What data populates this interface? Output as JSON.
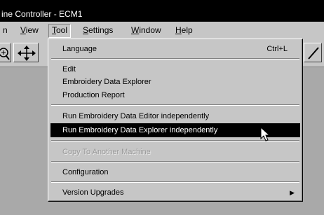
{
  "window": {
    "title": "ine Controller - ECM1"
  },
  "menubar": {
    "items": [
      {
        "label": "n",
        "underline": ""
      },
      {
        "label": "View",
        "underline": "V"
      },
      {
        "label": "Tool",
        "underline": "T"
      },
      {
        "label": "Settings",
        "underline": "S"
      },
      {
        "label": "Window",
        "underline": "W"
      },
      {
        "label": "Help",
        "underline": "H"
      }
    ],
    "active": "Tool"
  },
  "toolbar": {
    "icons": [
      "zoom-icon",
      "move-arrows-icon",
      "diagonal-arrow-icon"
    ]
  },
  "tool_menu": {
    "items": [
      {
        "label": "Language",
        "shortcut": "Ctrl+L"
      },
      {
        "label": "Edit"
      },
      {
        "label": "Embroidery Data Explorer"
      },
      {
        "label": "Production Report"
      },
      {
        "label": "Run Embroidery Data Editor independently"
      },
      {
        "label": "Run Embroidery Data Explorer independently",
        "state": "selected"
      },
      {
        "label": "Copy To Another Machine",
        "state": "disabled"
      },
      {
        "label": "Configuration"
      },
      {
        "label": "Version Upgrades",
        "submenu": true
      }
    ]
  },
  "colors": {
    "menu_background": "#c6c6c6",
    "selection": "#000000",
    "client_area": "#a9a9a9",
    "disabled_text": "#9a9a9a"
  }
}
